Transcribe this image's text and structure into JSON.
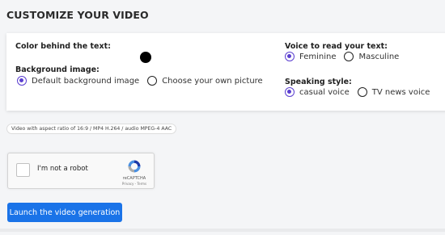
{
  "header": {
    "title": "CUSTOMIZE YOUR VIDEO"
  },
  "card": {
    "color_label": "Color behind the text:",
    "color_value": "#000000",
    "bg_label": "Background image:",
    "bg_options": [
      "Default background image",
      "Choose your own picture"
    ],
    "bg_selected": 0,
    "voice_label": "Voice to read your text:",
    "voice_options": [
      "Feminine",
      "Masculine"
    ],
    "voice_selected": 0,
    "style_label": "Speaking style:",
    "style_options": [
      "casual voice",
      "TV news voice"
    ],
    "style_selected": 0
  },
  "info": {
    "text": "Video with aspect ratio of 16:9 / MP4 H.264 / audio MPEG-4 AAC"
  },
  "recaptcha": {
    "label": "I'm not a robot",
    "brand": "reCAPTCHA",
    "terms": "Privacy - Terms"
  },
  "actions": {
    "launch_label": "Launch the video generation"
  },
  "colors": {
    "accent": "#5b3fd0",
    "button": "#1a73e8"
  }
}
